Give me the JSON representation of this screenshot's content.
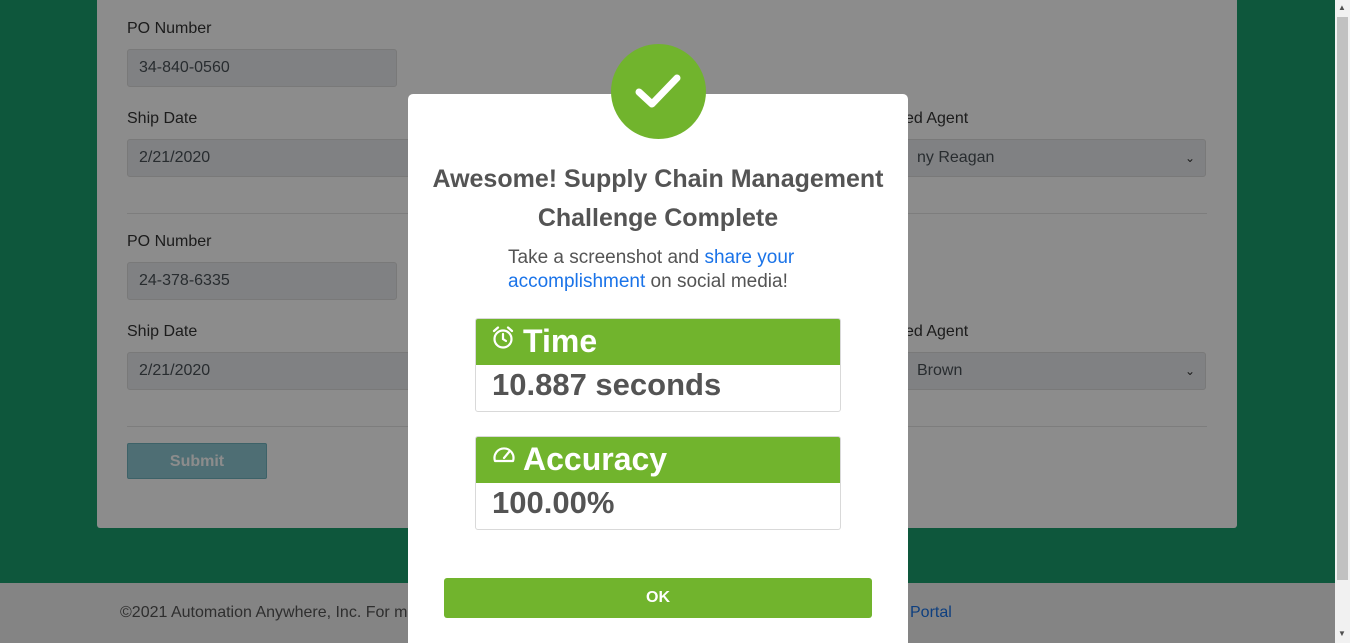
{
  "form": {
    "entries": [
      {
        "po_label": "PO Number",
        "po_value": "34-840-0560",
        "ship_label": "Ship Date",
        "ship_value": "2/21/2020",
        "agent_label_partial": "ed Agent",
        "agent_value_partial": "ny Reagan"
      },
      {
        "po_label": "PO Number",
        "po_value": "24-378-6335",
        "ship_label": "Ship Date",
        "ship_value": "2/21/2020",
        "agent_label_partial": "ed Agent",
        "agent_value_partial": " Brown"
      }
    ],
    "submit_label": "Submit"
  },
  "footer": {
    "text_partial": "©2021 Automation Anywhere, Inc. For m",
    "link_partial": "Portal"
  },
  "modal": {
    "title": "Awesome! Supply Chain Management Challenge Complete",
    "subtitle_pre": "Take a screenshot and ",
    "subtitle_link": "share your accomplishment",
    "subtitle_post": " on social media!",
    "time_label": "Time",
    "time_value": "10.887 seconds",
    "accuracy_label": "Accuracy",
    "accuracy_value": "100.00%",
    "ok_label": "OK"
  },
  "icons": {
    "success": "checkmark-icon",
    "time": "alarm-clock-icon",
    "accuracy": "gauge-icon",
    "select": "chevron-down-icon"
  },
  "colors": {
    "background_green": "#1a9e6e",
    "accent_green": "#71b42d",
    "link_blue": "#1a73e8",
    "submit_teal": "#8ec9d3"
  }
}
